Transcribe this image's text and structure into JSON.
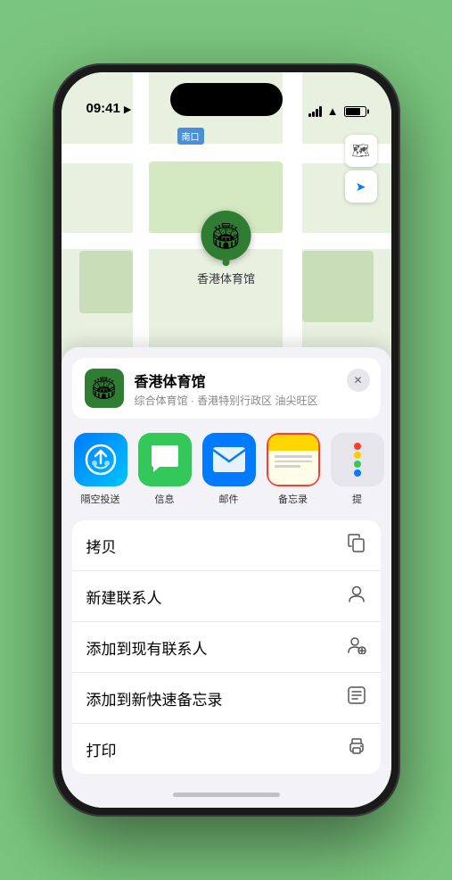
{
  "status_bar": {
    "time": "09:41",
    "location_arrow": "▲"
  },
  "map": {
    "label_text": "南口",
    "pin_label": "香港体育馆",
    "pin_emoji": "🏟️"
  },
  "map_controls": {
    "layers_icon": "🗺",
    "location_icon": "➤"
  },
  "location_card": {
    "name": "香港体育馆",
    "subtitle": "综合体育馆 · 香港特别行政区 油尖旺区",
    "close_label": "✕"
  },
  "share_items": [
    {
      "id": "airdrop",
      "label": "隔空投送",
      "type": "airdrop"
    },
    {
      "id": "message",
      "label": "信息",
      "type": "message"
    },
    {
      "id": "mail",
      "label": "邮件",
      "type": "mail"
    },
    {
      "id": "notes",
      "label": "备忘录",
      "type": "notes",
      "selected": true
    },
    {
      "id": "more",
      "label": "提",
      "type": "more"
    }
  ],
  "action_items": [
    {
      "id": "copy",
      "label": "拷贝",
      "icon": "copy"
    },
    {
      "id": "new-contact",
      "label": "新建联系人",
      "icon": "person"
    },
    {
      "id": "add-contact",
      "label": "添加到现有联系人",
      "icon": "person-add"
    },
    {
      "id": "quick-note",
      "label": "添加到新快速备忘录",
      "icon": "note"
    },
    {
      "id": "print",
      "label": "打印",
      "icon": "print"
    }
  ]
}
